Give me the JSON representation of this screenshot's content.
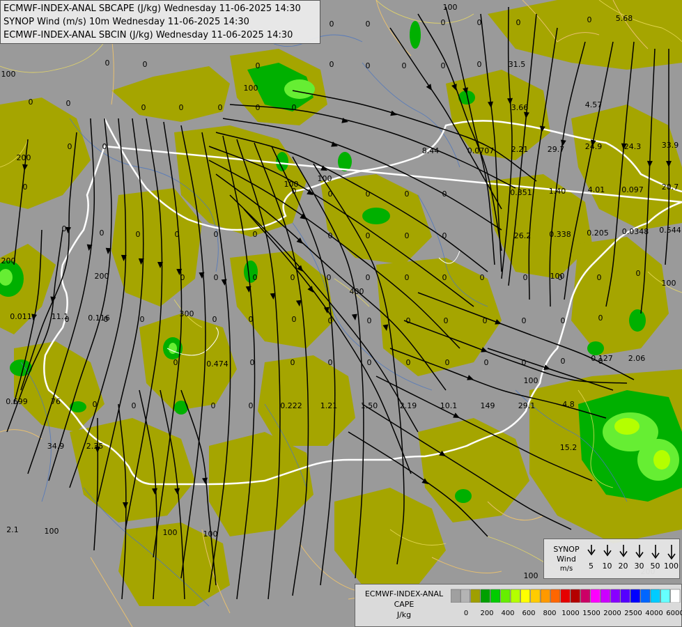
{
  "titles": [
    "ECMWF-INDEX-ANAL SBCAPE (J/kg) Wednesday 11-06-2025 14:30",
    "SYNOP Wind (m/s) 10m Wednesday 11-06-2025 14:30",
    "ECMWF-INDEX-ANAL SBCIN (J/kg) Wednesday 11-06-2025 14:30"
  ],
  "synop_legend": {
    "label_line1": "SYNOP",
    "label_line2": "Wind",
    "label_line3": "m/s",
    "speeds": [
      "5",
      "10",
      "20",
      "30",
      "50",
      "100"
    ]
  },
  "cape_legend": {
    "label_line1": "ECMWF-INDEX-ANAL",
    "label_line2": "CAPE",
    "label_line3": "J/kg",
    "tick_labels": [
      "0",
      "200",
      "400",
      "600",
      "800",
      "1000",
      "1500",
      "2000",
      "2500",
      "4000",
      "6000"
    ],
    "colors": [
      "#a0a0a0",
      "#b4b4b4",
      "#9f9f00",
      "#00a000",
      "#00cc00",
      "#66ee00",
      "#b4ff00",
      "#ffff00",
      "#ffcc00",
      "#ff9900",
      "#ff6600",
      "#e60000",
      "#b40000",
      "#cc0066",
      "#ff00ff",
      "#cc00ff",
      "#8800ff",
      "#5500ff",
      "#0000ff",
      "#0066ff",
      "#00ccff",
      "#66ffff",
      "#ffffff"
    ]
  },
  "colors": {
    "background_gray": "#9a9a9a",
    "cape_low": "#a5a500",
    "cape_200": "#00b000",
    "cape_400": "#66ee33",
    "streamline": "#000000",
    "border": "#ffffff"
  },
  "field_values": [
    "0",
    "0",
    "0",
    "0",
    "0",
    "0",
    "0",
    "0",
    "0",
    "0",
    "0",
    "0",
    "0",
    "0",
    "0",
    "0",
    "0",
    "0",
    "0",
    "0",
    "0",
    "0",
    "0",
    "0",
    "0",
    "0",
    "0",
    "0",
    "0",
    "0",
    "0",
    "0",
    "0",
    "0",
    "0",
    "0",
    "0",
    "0",
    "0",
    "0",
    "0",
    "0",
    "0",
    "0",
    "0",
    "0",
    "0",
    "0",
    "0",
    "0",
    "0",
    "0",
    "0",
    "0",
    "0",
    "0",
    "0",
    "0",
    "0",
    "0",
    "0",
    "0",
    "0",
    "0",
    "0",
    "0",
    "0",
    "0",
    "0",
    "0",
    "0",
    "0",
    "0",
    "0",
    "0",
    "0",
    "0",
    "0",
    "0",
    "0",
    "0",
    "0",
    "0.222",
    "1.21",
    "1.50",
    "2.19",
    "149",
    "29.1",
    "5.68",
    "31.5",
    "3.66",
    "4.57",
    "8.44",
    "0.0707",
    "2.21",
    "29.7",
    "24.9",
    "24.3",
    "33.9",
    "0.351",
    "1.40",
    "4.01",
    "0.097",
    "20.7",
    "26.2",
    "0.338",
    "0.205",
    "0.0348",
    "0.544",
    "0.011",
    "11.1",
    "0.116",
    "0.474",
    "0.699",
    "76",
    "2.35",
    "34.9",
    "10.1",
    "4.8",
    "0.127",
    "2.06",
    "15.2",
    "2.1",
    "100",
    "100",
    "100",
    "100",
    "200",
    "200",
    "100",
    "100",
    "200",
    "100",
    "100",
    "100",
    "200",
    "300",
    "400",
    "100",
    "100",
    "100"
  ]
}
